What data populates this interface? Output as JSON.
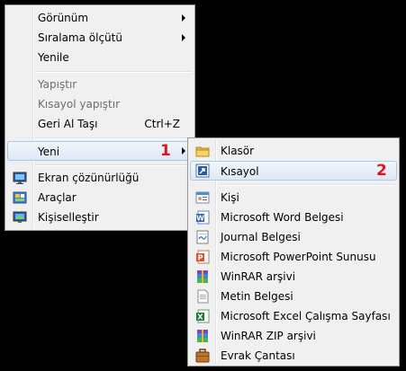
{
  "main_menu": {
    "items": [
      {
        "label": "Görünüm"
      },
      {
        "label": "Sıralama ölçütü"
      },
      {
        "label": "Yenile"
      },
      {
        "label": "Yapıştır"
      },
      {
        "label": "Kısayol yapıştır"
      },
      {
        "label": "Geri Al Taşı",
        "shortcut": "Ctrl+Z"
      },
      {
        "label": "Yeni"
      },
      {
        "label": "Ekran çözünürlüğü"
      },
      {
        "label": "Araçlar"
      },
      {
        "label": "Kişiselleştir"
      }
    ]
  },
  "sub_menu": {
    "items": [
      {
        "label": "Klasör",
        "icon": "folder-icon"
      },
      {
        "label": "Kısayol",
        "icon": "shortcut-icon"
      },
      {
        "label": "Kişi",
        "icon": "contact-icon"
      },
      {
        "label": "Microsoft Word Belgesi",
        "icon": "word-icon"
      },
      {
        "label": "Journal Belgesi",
        "icon": "journal-icon"
      },
      {
        "label": "Microsoft PowerPoint Sunusu",
        "icon": "powerpoint-icon"
      },
      {
        "label": "WinRAR arşivi",
        "icon": "winrar-icon"
      },
      {
        "label": "Metin Belgesi",
        "icon": "text-document-icon"
      },
      {
        "label": "Microsoft Excel Çalışma Sayfası",
        "icon": "excel-icon"
      },
      {
        "label": "WinRAR ZIP arşivi",
        "icon": "winrar-zip-icon"
      },
      {
        "label": "Evrak Çantası",
        "icon": "briefcase-icon"
      }
    ]
  },
  "annotations": {
    "step1": "1",
    "step2": "2"
  },
  "colors": {
    "annotation": "#e4141b",
    "highlight_border": "#a8c8ec",
    "menu_bg": "#f0f0f0"
  }
}
